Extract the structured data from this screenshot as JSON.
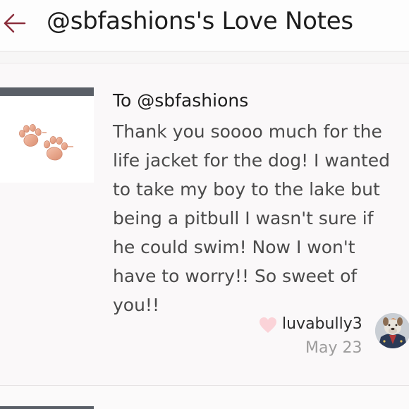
{
  "header": {
    "title": "@sbfashions's Love Notes",
    "back_icon": "back-arrow-icon",
    "accent_color": "#8b2e3c"
  },
  "note": {
    "recipient": "To @sbfashions",
    "message_lines": [
      "Thank you soooo much for the",
      "life jacket for the dog! I wanted",
      "to take my boy to the lake but",
      "being a pitbull I wasn't sure if",
      "he could swim! Now I won't",
      "have to worry!! So sweet of",
      "you!!"
    ],
    "author": "luvabully3",
    "date": "May 23",
    "heart_icon": "heart-icon",
    "heart_color": "#fbd3d8",
    "thumbnail": "paw-print-earrings",
    "avatar": "pitbull-avatar"
  }
}
